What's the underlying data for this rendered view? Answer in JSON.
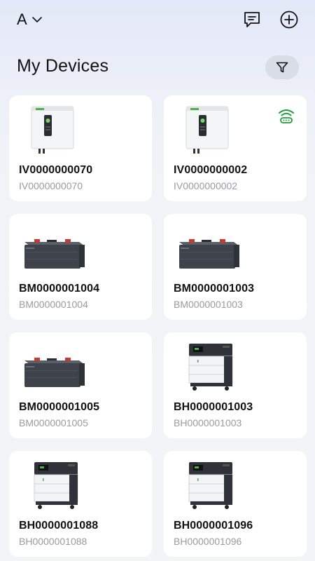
{
  "header": {
    "account_label": "A",
    "icons": {
      "account_menu": "chevron-down-icon",
      "messages": "message-icon",
      "add": "plus-circle-icon"
    }
  },
  "page": {
    "title": "My Devices",
    "filter_icon": "filter-icon"
  },
  "colors": {
    "card_bg": "#ffffff",
    "online_green": "#1f9d3a",
    "subtitle_gray": "#9a9aa0",
    "filter_bg": "#d9dde7"
  },
  "devices": [
    {
      "name": "IV0000000070",
      "serial": "IV0000000070",
      "type": "inverter",
      "online": false
    },
    {
      "name": "IV0000000002",
      "serial": "IV0000000002",
      "type": "inverter",
      "online": true
    },
    {
      "name": "BM0000001004",
      "serial": "BM0000001004",
      "type": "battery-module",
      "online": false
    },
    {
      "name": "BM0000001003",
      "serial": "BM0000001003",
      "type": "battery-module",
      "online": false
    },
    {
      "name": "BM0000001005",
      "serial": "BM0000001005",
      "type": "battery-module",
      "online": false
    },
    {
      "name": "BH0000001003",
      "serial": "BH0000001003",
      "type": "battery-stack",
      "online": false
    },
    {
      "name": "BH0000001088",
      "serial": "BH0000001088",
      "type": "battery-stack",
      "online": false
    },
    {
      "name": "BH0000001096",
      "serial": "BH0000001096",
      "type": "battery-stack",
      "online": false
    }
  ]
}
